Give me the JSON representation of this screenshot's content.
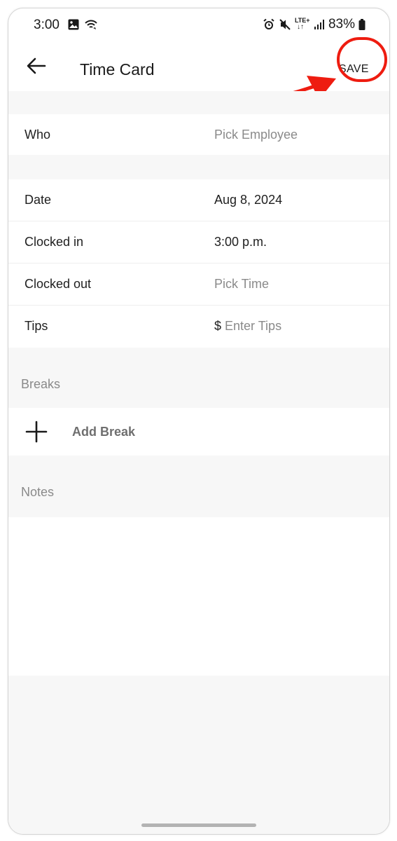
{
  "status_bar": {
    "time": "3:00",
    "left_icons": [
      "image-icon",
      "wifi-calling-icon"
    ],
    "right_icons": [
      "alarm-icon",
      "mute-icon",
      "lte-icon",
      "signal-icon"
    ],
    "lte_label": "LTE+",
    "battery_percent": "83%"
  },
  "app_bar": {
    "title": "Time Card",
    "save_label": "SAVE"
  },
  "form": {
    "who": {
      "label": "Who",
      "value": "Pick Employee"
    },
    "date": {
      "label": "Date",
      "value": "Aug 8, 2024"
    },
    "clocked_in": {
      "label": "Clocked in",
      "value": "3:00 p.m."
    },
    "clocked_out": {
      "label": "Clocked out",
      "value": "Pick Time"
    },
    "tips": {
      "label": "Tips",
      "currency": "$",
      "placeholder": "Enter Tips"
    }
  },
  "breaks": {
    "section_title": "Breaks",
    "add_label": "Add Break"
  },
  "notes": {
    "section_title": "Notes"
  },
  "colors": {
    "annotation": "#ee1c10",
    "section_bg": "#f7f7f7",
    "placeholder_text": "#8a8a8a"
  }
}
